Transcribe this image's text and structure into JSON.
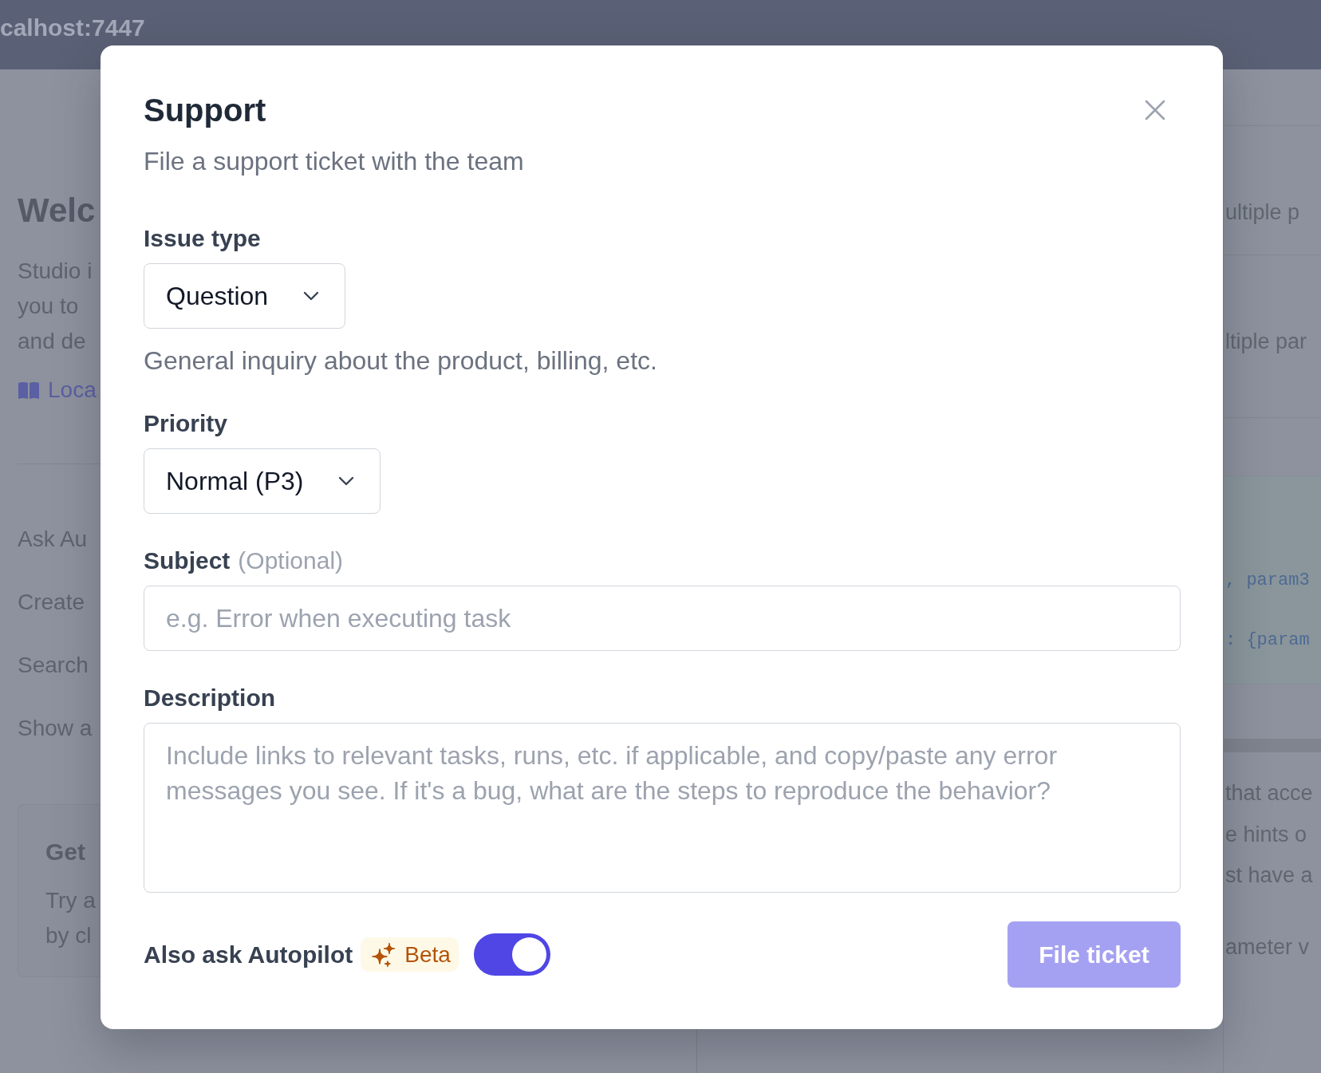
{
  "browser_bar": {
    "address": "calhost:7447"
  },
  "page": {
    "heading": "Welc",
    "intro_lines": [
      "Studio i",
      "you to",
      "and de"
    ],
    "link": "Loca",
    "actions": [
      "Ask Au",
      "Create",
      "Search",
      "Show a"
    ],
    "card": {
      "title": "Get",
      "lines": [
        "Try a",
        "by cl"
      ]
    }
  },
  "side_panel": {
    "rows": [
      "ultiple p",
      "ltiple par"
    ],
    "code_lines": [
      ", param3",
      ": {param"
    ],
    "paragraphs": [
      [
        "that acce",
        "e hints o",
        "st have a"
      ],
      [
        "ameter v"
      ]
    ]
  },
  "dialog": {
    "title": "Support",
    "subtitle": "File a support ticket with the team",
    "fields": [
      {
        "kind": "select",
        "label": "Issue type",
        "value": "Question",
        "help": "General inquiry about the product, billing, etc."
      },
      {
        "kind": "select",
        "label": "Priority",
        "value": "Normal (P3)"
      },
      {
        "kind": "input",
        "label": "Subject",
        "hint": "(Optional)",
        "placeholder": "e.g. Error when executing task"
      },
      {
        "kind": "textarea",
        "label": "Description",
        "placeholder": "Include links to relevant tasks, runs, etc. if applicable, and copy/paste any error messages you see. If it's a bug, what are the steps to reproduce the behavior?"
      }
    ],
    "autopilot": {
      "label": "Also ask Autopilot",
      "badge": "Beta",
      "on": true
    },
    "submit": {
      "label": "File ticket",
      "disabled": true
    }
  }
}
